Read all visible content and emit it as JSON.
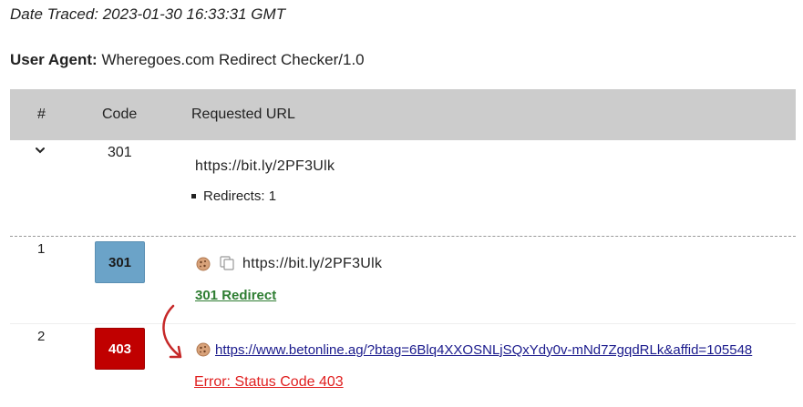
{
  "trace": {
    "date_traced": "Date Traced: 2023-01-30 16:33:31 GMT",
    "user_agent_label": "User Agent:",
    "user_agent_value": "Wheregoes.com Redirect Checker/1.0"
  },
  "table": {
    "headers": [
      "#",
      "Code",
      "Requested URL"
    ]
  },
  "summary": {
    "code": "301",
    "url": "https://bit.ly/2PF3Ulk",
    "redirects": "Redirects: 1"
  },
  "hops": [
    {
      "number": "1",
      "code": "301",
      "url": "https://bit.ly/2PF3Ulk",
      "status": "301 Redirect"
    },
    {
      "number": "2",
      "code": "403",
      "url": "https://www.betonline.ag/?btag=6Blq4XXOSNLjSQxYdy0v-mNd7ZgqdRLk&affid=105548",
      "status": "Error: Status Code 403"
    }
  ],
  "colors": {
    "header_bg": "#cccccc",
    "badge_301": "#6ba3c8",
    "badge_403": "#c00000",
    "redirect_green": "#2e7d32",
    "error_red": "#e02020",
    "arrow_red": "#c62828"
  },
  "icons": [
    "chevron-down-icon",
    "cookie-icon",
    "copy-icon",
    "curved-arrow-icon"
  ]
}
